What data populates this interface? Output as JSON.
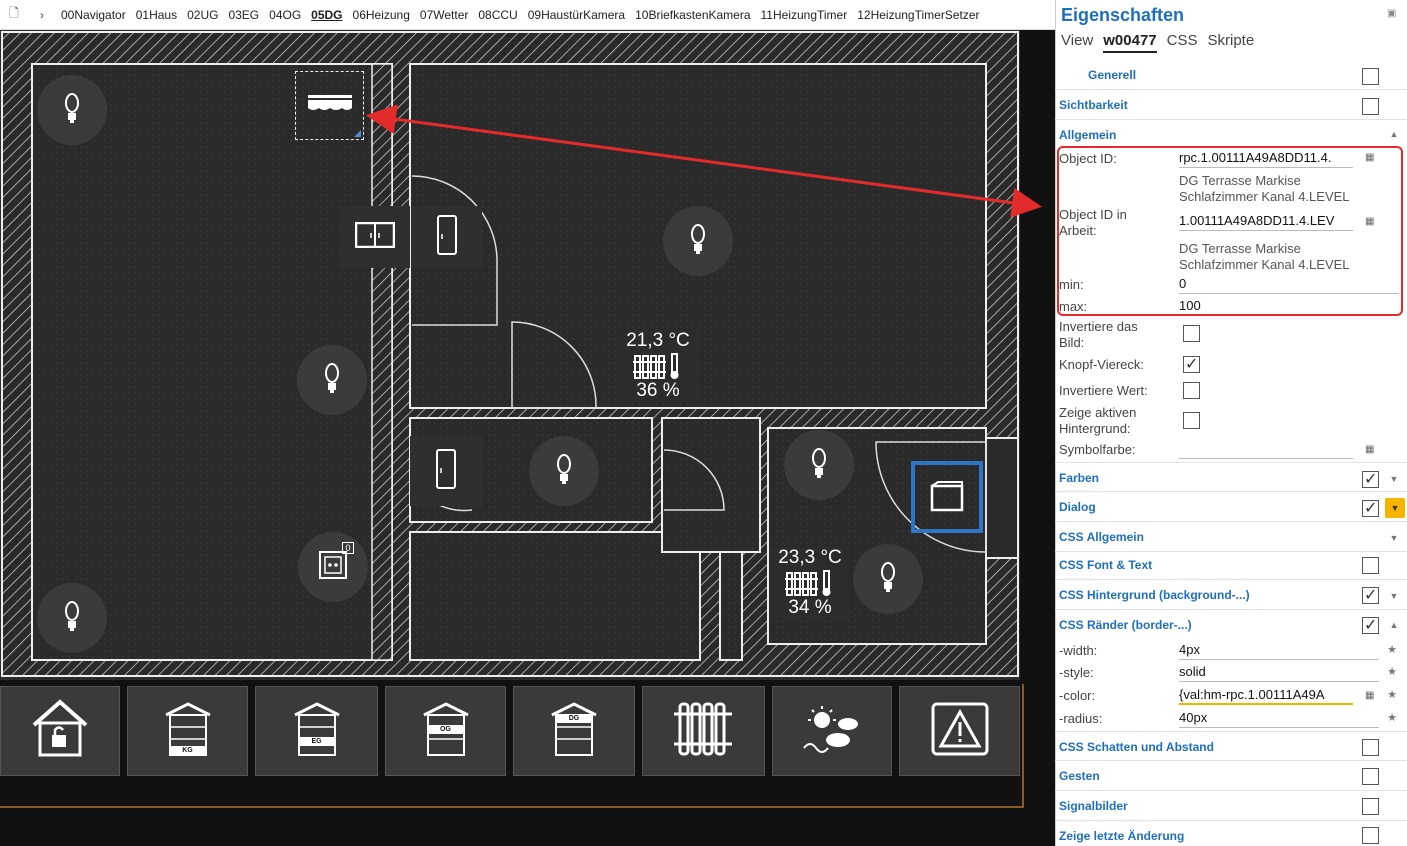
{
  "tabbar": {
    "tabs": [
      "00Navigator",
      "01Haus",
      "02UG",
      "03EG",
      "04OG",
      "05DG",
      "06Heizung",
      "07Wetter",
      "08CCU",
      "09HaustürKamera",
      "10BriefkastenKamera",
      "11HeizungTimer",
      "12HeizungTimerSetzer"
    ],
    "active_index": 5
  },
  "plan": {
    "climate1": {
      "temp": "21,3 °C",
      "humidity": "36 %"
    },
    "climate2": {
      "temp": "23,3 °C",
      "humidity": "34 %"
    },
    "socket_badge": "0"
  },
  "bottomnav": {
    "buttons": [
      {
        "icon": "house-lock-icon"
      },
      {
        "icon": "house-kg-icon",
        "label": "KG"
      },
      {
        "icon": "house-eg-icon",
        "label": "EG"
      },
      {
        "icon": "house-og-icon",
        "label": "OG"
      },
      {
        "icon": "house-dg-icon",
        "label": "DG"
      },
      {
        "icon": "radiator-icon"
      },
      {
        "icon": "weather-icon"
      },
      {
        "icon": "warning-icon"
      }
    ]
  },
  "props": {
    "title": "Eigenschaften",
    "tabs": [
      "View",
      "w00477",
      "CSS",
      "Skripte"
    ],
    "active_tab": "w00477",
    "groups": {
      "generell": "Generell",
      "sichtbarkeit": "Sichtbarkeit",
      "allgemein": "Allgemein",
      "farben": "Farben",
      "dialog": "Dialog",
      "css_allgemein": "CSS Allgemein",
      "css_font": "CSS Font & Text",
      "css_bg": "CSS Hintergrund (background-...)",
      "css_border": "CSS Ränder (border-...)",
      "css_shadow": "CSS Schatten und Abstand",
      "gesten": "Gesten",
      "signalbilder": "Signalbilder",
      "letzte": "Zeige letzte Änderung"
    },
    "allgemein": {
      "oid_label": "Object ID:",
      "oid_value": "rpc.1.00111A49A8DD11.4.",
      "oid_desc1": "DG Terrasse Markise",
      "oid_desc2": "Schlafzimmer Kanal 4.LEVEL",
      "oid_work_label1": "Object ID in",
      "oid_work_label2": "Arbeit:",
      "oid_work_value": "1.00111A49A8DD11.4.LEV",
      "oid_work_desc1": "DG Terrasse Markise",
      "oid_work_desc2": "Schlafzimmer Kanal 4.LEVEL",
      "min_label": "min:",
      "min_value": "0",
      "max_label": "max:",
      "max_value": "100",
      "invert_img_label1": "Invertiere das",
      "invert_img_label2": "Bild:",
      "knopf_label": "Knopf-Viereck:",
      "invert_val_label": "Invertiere Wert:",
      "active_bg_label1": "Zeige aktiven",
      "active_bg_label2": "Hintergrund:",
      "symbol_label": "Symbolfarbe:"
    },
    "border": {
      "width_label": "-width:",
      "width_value": "4px",
      "style_label": "-style:",
      "style_value": "solid",
      "color_label": "-color:",
      "color_value": "{val:hm-rpc.1.00111A49A",
      "radius_label": "-radius:",
      "radius_value": "40px"
    }
  },
  "colors": {
    "accent": "#1e6fbf",
    "highlight": "#e32b2b",
    "selection": "#2f75c6",
    "dialog_button": "#f5b400"
  }
}
